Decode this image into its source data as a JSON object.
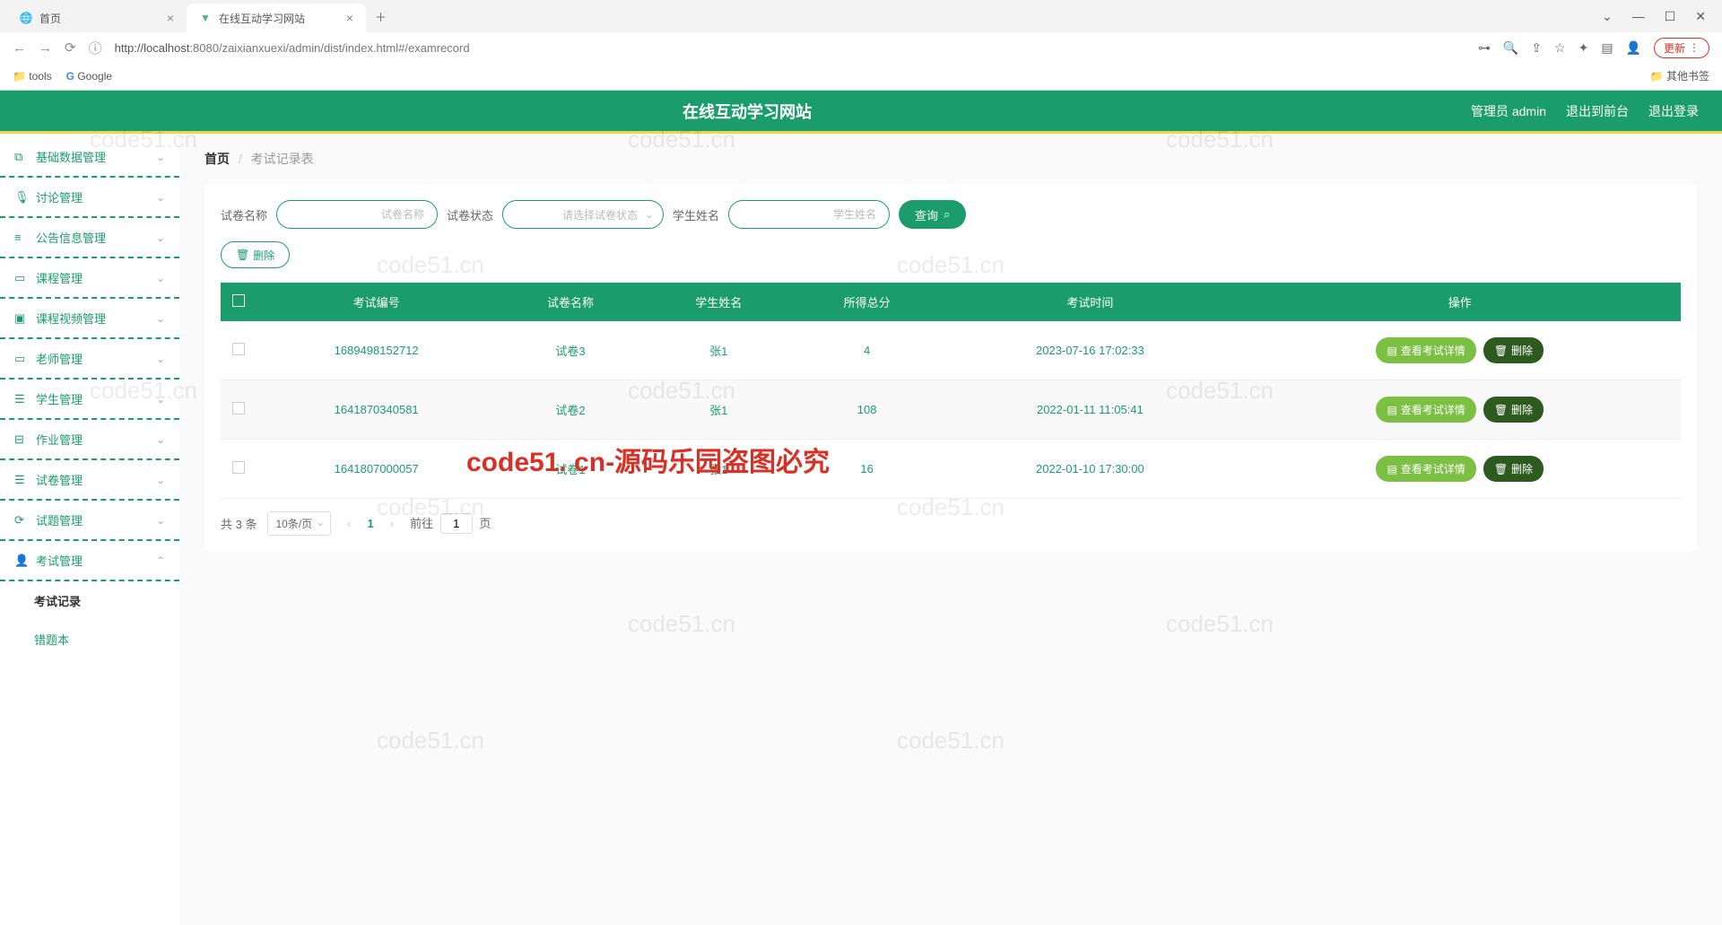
{
  "browser": {
    "tabs": [
      {
        "title": "首页",
        "active": false
      },
      {
        "title": "在线互动学习网站",
        "active": true
      }
    ],
    "url_prefix": "http://",
    "url_host": "localhost",
    "url_port_path": ":8080/zaixianxuexi/admin/dist/index.html#/examrecord",
    "update": "更新",
    "bookmarks": {
      "tools": "tools",
      "google": "Google",
      "other": "其他书签"
    }
  },
  "header": {
    "title": "在线互动学习网站",
    "links": {
      "admin": "管理员 admin",
      "front": "退出到前台",
      "logout": "退出登录"
    }
  },
  "sidebar": {
    "items": [
      {
        "label": "基础数据管理",
        "icon": "⧉"
      },
      {
        "label": "讨论管理",
        "icon": "🎙"
      },
      {
        "label": "公告信息管理",
        "icon": "≡"
      },
      {
        "label": "课程管理",
        "icon": "▭"
      },
      {
        "label": "课程视频管理",
        "icon": "▣"
      },
      {
        "label": "老师管理",
        "icon": "▭"
      },
      {
        "label": "学生管理",
        "icon": "☰"
      },
      {
        "label": "作业管理",
        "icon": "⊟"
      },
      {
        "label": "试卷管理",
        "icon": "☰"
      },
      {
        "label": "试题管理",
        "icon": "⟳"
      },
      {
        "label": "考试管理",
        "icon": "👤",
        "expanded": true
      }
    ],
    "subs": {
      "exam_record": "考试记录",
      "error_book": "错题本"
    }
  },
  "breadcrumb": {
    "home": "首页",
    "current": "考试记录表"
  },
  "filters": {
    "paper_name_label": "试卷名称",
    "paper_name_ph": "试卷名称",
    "paper_status_label": "试卷状态",
    "paper_status_ph": "请选择试卷状态",
    "student_name_label": "学生姓名",
    "student_name_ph": "学生姓名",
    "search": "查询",
    "delete": "删除"
  },
  "table": {
    "headers": [
      "考试编号",
      "试卷名称",
      "学生姓名",
      "所得总分",
      "考试时间",
      "操作"
    ],
    "actions": {
      "view": "查看考试详情",
      "delete": "删除"
    },
    "rows": [
      {
        "id": "1689498152712",
        "paper": "试卷3",
        "student": "张1",
        "score": "4",
        "time": "2023-07-16 17:02:33"
      },
      {
        "id": "1641870340581",
        "paper": "试卷2",
        "student": "张1",
        "score": "108",
        "time": "2022-01-11 11:05:41"
      },
      {
        "id": "1641807000057",
        "paper": "试卷1",
        "student": "张1",
        "score": "16",
        "time": "2022-01-10 17:30:00"
      }
    ]
  },
  "pagination": {
    "total": "共 3 条",
    "per_page": "10条/页",
    "page": "1",
    "goto_prefix": "前往",
    "goto_val": "1",
    "goto_suffix": "页"
  },
  "watermark": "code51.cn",
  "watermark_red": "code51. cn-源码乐园盗图必究"
}
